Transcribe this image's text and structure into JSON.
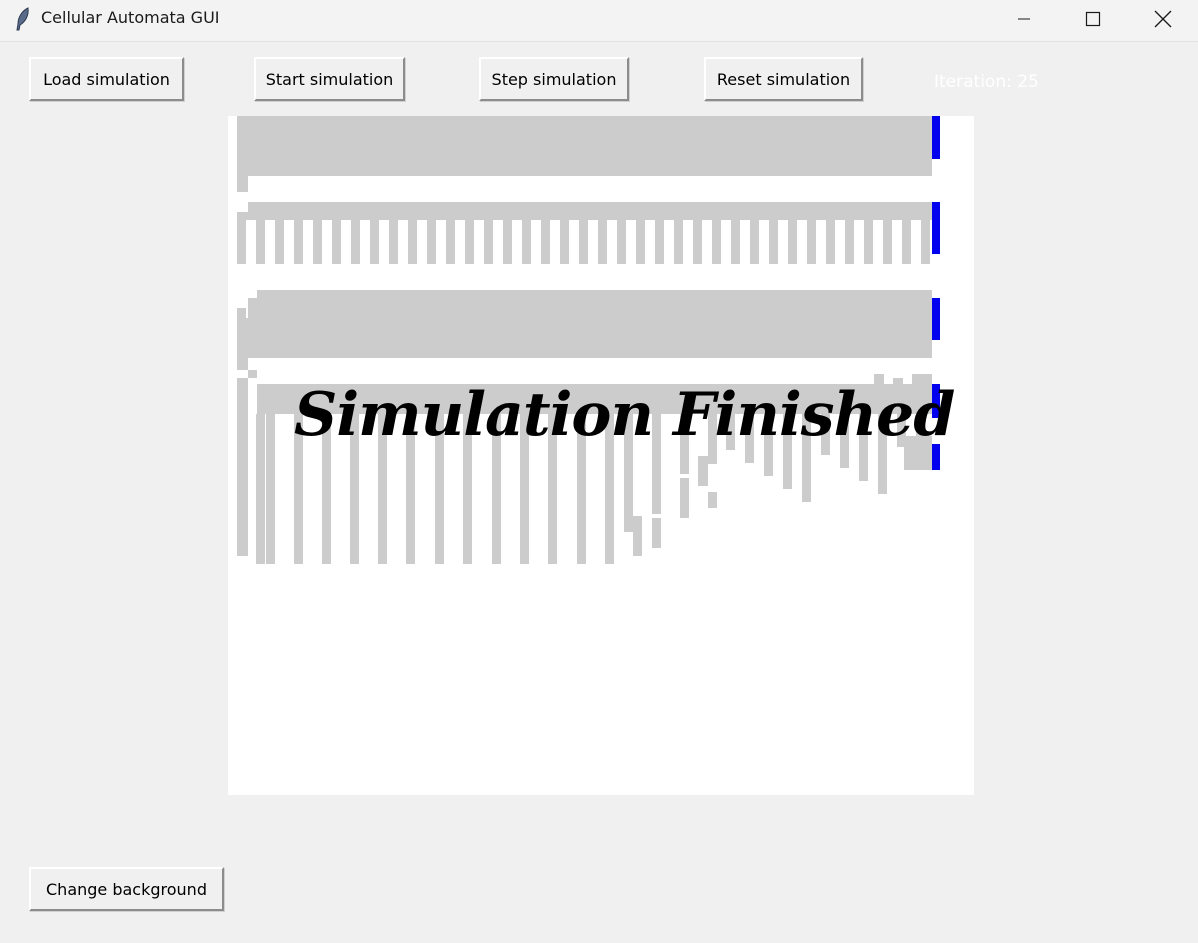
{
  "window": {
    "title": "Cellular Automata GUI",
    "icon": "feather-icon",
    "controls": {
      "minimize": "minimize-icon",
      "maximize": "maximize-icon",
      "close": "close-icon"
    }
  },
  "toolbar": {
    "load_label": "Load simulation",
    "start_label": "Start simulation",
    "step_label": "Step simulation",
    "reset_label": "Reset simulation",
    "iteration_label": "Iteration: 25"
  },
  "canvas": {
    "overlay_text": "Simulation Finished",
    "colors": {
      "cell": "#cccccc",
      "marker": "#0000ee",
      "background": "#ffffff"
    }
  },
  "footer": {
    "change_background_label": "Change background"
  }
}
